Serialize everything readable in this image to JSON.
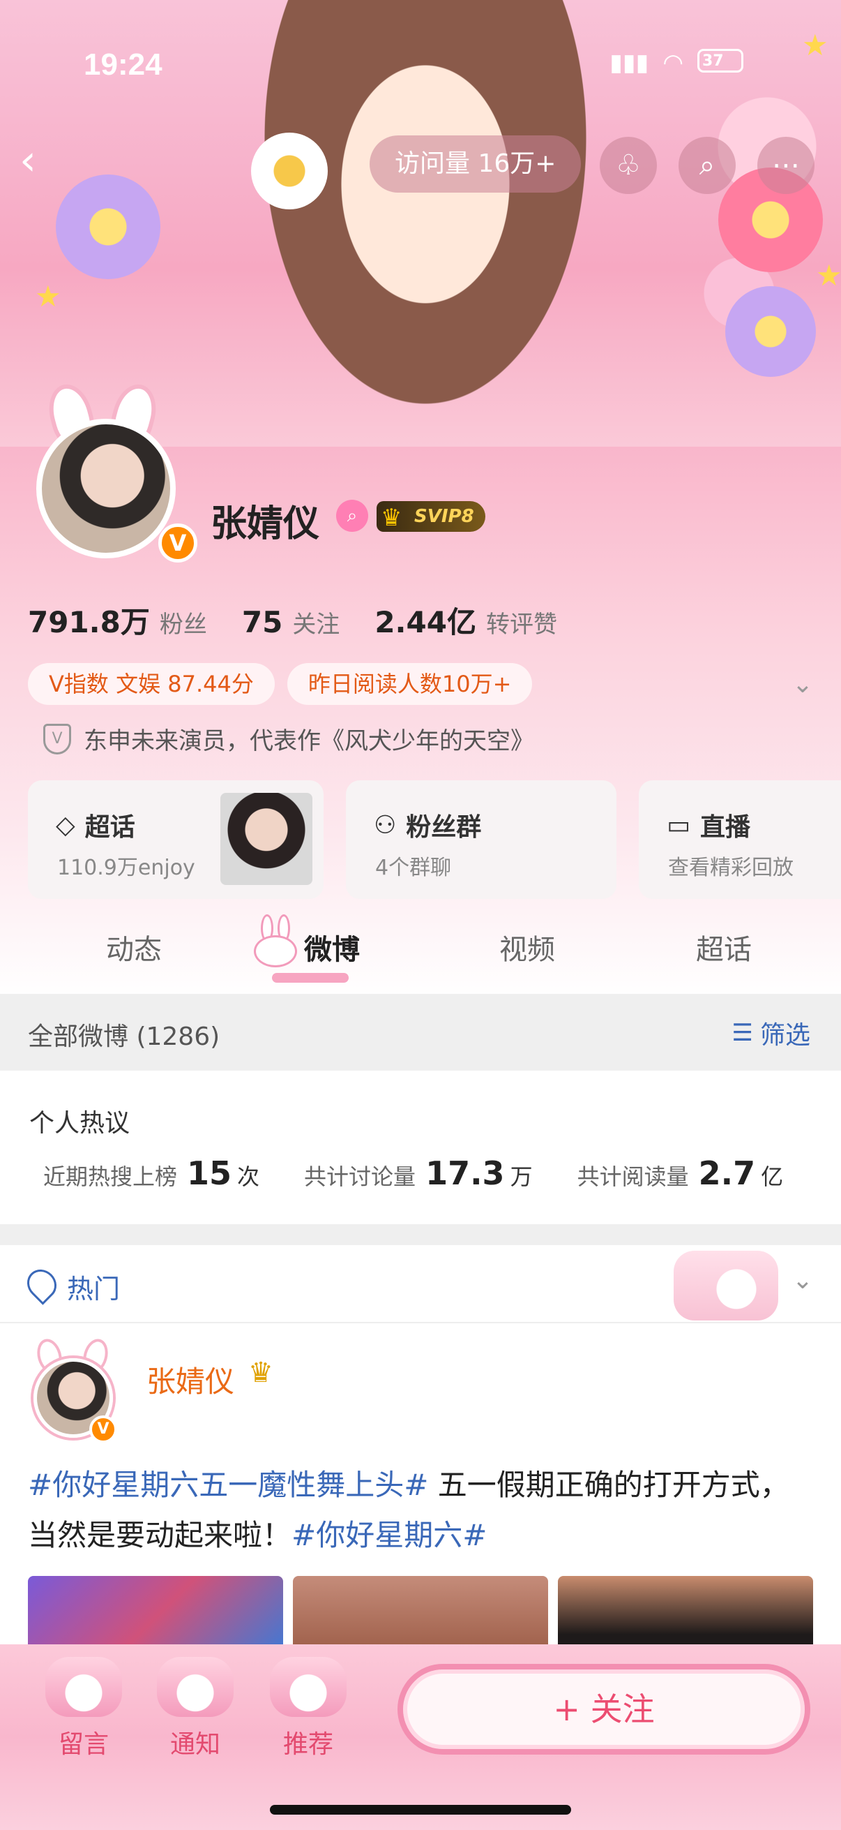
{
  "status": {
    "time": "19:24",
    "battery": "37"
  },
  "nav": {
    "visits": "访问量 16万+"
  },
  "profile": {
    "name": "张婧仪",
    "svip": "SVIP8",
    "followers_num": "791.8万",
    "followers_label": "粉丝",
    "following_num": "75",
    "following_label": "关注",
    "likes_num": "2.44亿",
    "likes_label": "转评赞",
    "tags": [
      "V指数 文娱 87.44分",
      "昨日阅读人数10万+"
    ],
    "bio": "东申未来演员，代表作《风犬少年的天空》",
    "verified_badge": "V"
  },
  "cards": [
    {
      "title": "超话",
      "sub": "110.9万enjoy",
      "icon": "diamond-icon"
    },
    {
      "title": "粉丝群",
      "sub": "4个群聊",
      "icon": "group-icon"
    },
    {
      "title": "直播",
      "sub": "查看精彩回放",
      "icon": "tv-icon"
    }
  ],
  "tabs": [
    "动态",
    "微博",
    "视频",
    "超话"
  ],
  "all_posts": {
    "title": "全部微博 (1286)",
    "filter": "筛选"
  },
  "hot_discuss": {
    "title": "个人热议",
    "items": [
      {
        "label": "近期热搜上榜",
        "num": "15",
        "unit": "次"
      },
      {
        "label": "共计讨论量",
        "num": "17.3",
        "unit": "万"
      },
      {
        "label": "共计阅读量",
        "num": "2.7",
        "unit": "亿"
      }
    ]
  },
  "hot_header": {
    "label": "热门"
  },
  "post": {
    "author": "张婧仪",
    "topic1": "#你好星期六五一魔性舞上头#",
    "text": " 五一假期正确的打开方式，当然是要动起来啦！",
    "topic2": "#你好星期六#"
  },
  "bottom": {
    "items": [
      "留言",
      "通知",
      "推荐"
    ],
    "follow": "+ 关注"
  },
  "colors": {
    "accent_pink": "#f38fb1",
    "link_blue": "#3a68b8",
    "name_orange": "#ea6a16"
  }
}
